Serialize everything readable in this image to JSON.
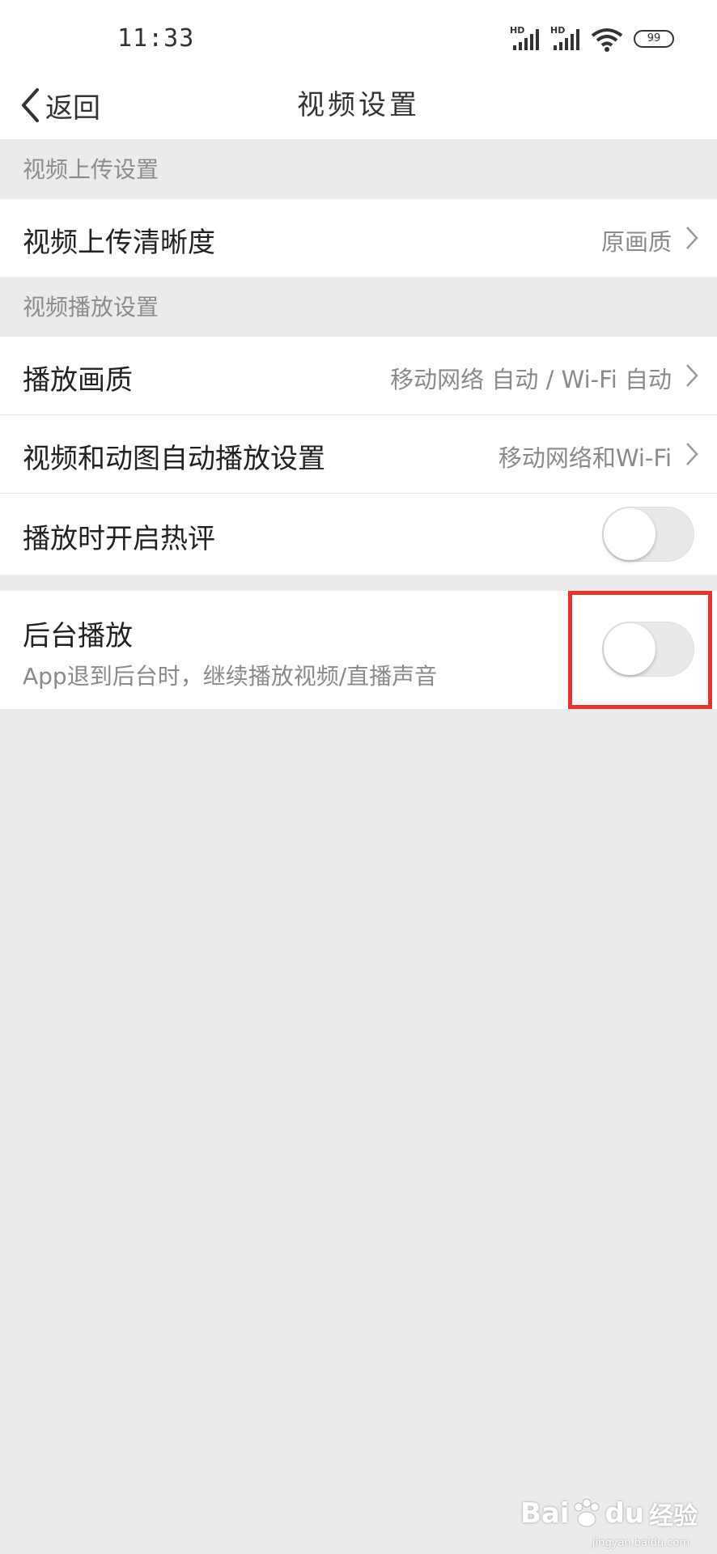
{
  "status_bar": {
    "time": "11:33",
    "signal1_label": "HD",
    "signal2_label": "HD",
    "battery": "99"
  },
  "nav": {
    "back_label": "返回",
    "title": "视频设置"
  },
  "sections": {
    "upload_header": "视频上传设置",
    "playback_header": "视频播放设置"
  },
  "rows": {
    "upload_quality": {
      "label": "视频上传清晰度",
      "value": "原画质"
    },
    "play_quality": {
      "label": "播放画质",
      "value": "移动网络 自动 / Wi-Fi 自动"
    },
    "autoplay": {
      "label": "视频和动图自动播放设置",
      "value": "移动网络和Wi-Fi"
    },
    "hot_comments": {
      "label": "播放时开启热评",
      "enabled": false
    },
    "background_play": {
      "label": "后台播放",
      "description": "App退到后台时，继续播放视频/直播声音",
      "enabled": false
    }
  },
  "watermark": {
    "brand": "Bai",
    "brand2": "du",
    "suffix": "经验",
    "url": "jingyan.baidu.com"
  },
  "colors": {
    "accent_highlight": "#e8342f",
    "background": "#ebebeb",
    "toggle_off": "#e9e9e9"
  }
}
